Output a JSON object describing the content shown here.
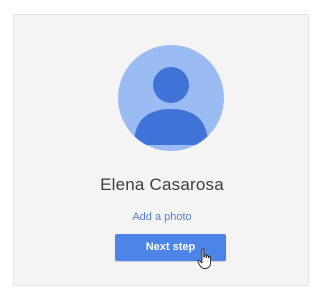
{
  "profile": {
    "name": "Elena Casarosa",
    "add_photo_label": "Add a photo",
    "next_button_label": "Next step"
  },
  "colors": {
    "avatar_bg": "#9bbcf3",
    "avatar_figure": "#3f73d8",
    "button_bg": "#4d84e8",
    "link": "#5b7fd6"
  },
  "icons": {
    "avatar": "person-icon",
    "pointer": "hand-cursor-icon"
  }
}
